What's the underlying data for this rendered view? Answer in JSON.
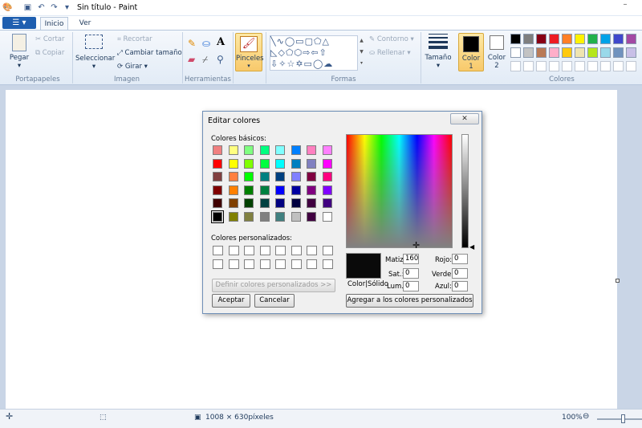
{
  "window": {
    "title": "Sin título - Paint"
  },
  "tabs": {
    "file": "☰ ▾",
    "inicio": "Inicio",
    "ver": "Ver"
  },
  "ribbon": {
    "portapapeles": {
      "label": "Portapapeles",
      "pegar": "Pegar",
      "cortar": "Cortar",
      "copiar": "Copiar"
    },
    "imagen": {
      "label": "Imagen",
      "seleccionar": "Seleccionar",
      "recortar": "Recortar",
      "cambiar_tamano": "Cambiar tamaño",
      "girar": "Girar"
    },
    "herramientas": {
      "label": "Herramientas"
    },
    "pinceles": {
      "label": "Pinceles"
    },
    "formas": {
      "label": "Formas",
      "contorno": "Contorno",
      "rellenar": "Rellenar"
    },
    "tamano": {
      "label": "Tamaño"
    },
    "color1": {
      "label": "Color",
      "sub": "1",
      "value": "#000000"
    },
    "color2": {
      "label": "Color",
      "sub": "2",
      "value": "#ffffff"
    },
    "colores": {
      "label": "Colores"
    }
  },
  "palette": {
    "row1": [
      "#000000",
      "#7f7f7f",
      "#880015",
      "#ed1c24",
      "#ff7f27",
      "#fff200",
      "#22b14c",
      "#00a2e8",
      "#3f48cc",
      "#a349a4"
    ],
    "row2": [
      "#ffffff",
      "#c3c3c3",
      "#b97a57",
      "#ffaec9",
      "#ffc90e",
      "#efe4b0",
      "#b5e61d",
      "#99d9ea",
      "#7092be",
      "#c8bfe7"
    ]
  },
  "dialog": {
    "title": "Editar colores",
    "close": "✕",
    "basic_label": "Colores básicos:",
    "custom_label": "Colores personalizados:",
    "basic_colors": [
      "#f08080",
      "#ffff80",
      "#80ff80",
      "#00ff80",
      "#80ffff",
      "#0080ff",
      "#ff80c0",
      "#ff80ff",
      "#ff0000",
      "#ffff00",
      "#80ff00",
      "#00ff40",
      "#00ffff",
      "#0080c0",
      "#8080c0",
      "#ff00ff",
      "#804040",
      "#ff8040",
      "#00ff00",
      "#008080",
      "#004080",
      "#8080ff",
      "#800040",
      "#ff0080",
      "#800000",
      "#ff8000",
      "#008000",
      "#008040",
      "#0000ff",
      "#0000a0",
      "#800080",
      "#8000ff",
      "#400000",
      "#804000",
      "#004000",
      "#004040",
      "#000080",
      "#000040",
      "#400040",
      "#400080",
      "#000000",
      "#808000",
      "#808040",
      "#808080",
      "#408080",
      "#c0c0c0",
      "#400040",
      "#ffffff"
    ],
    "define_custom": "Definir colores personalizados >>",
    "accept": "Aceptar",
    "cancel": "Cancelar",
    "add_custom": "Agregar a los colores personalizados",
    "preview_label": "Color|Sólido",
    "matiz_label": "Matiz:",
    "matiz": "160",
    "sat_label": "Sat.:",
    "sat": "0",
    "lum_label": "Lum.:",
    "lum": "0",
    "rojo_label": "Rojo:",
    "rojo": "0",
    "verde_label": "Verde:",
    "verde": "0",
    "azul_label": "Azul:",
    "azul": "0"
  },
  "status": {
    "dimensions": "1008 × 630píxeles",
    "zoom": "100%"
  }
}
